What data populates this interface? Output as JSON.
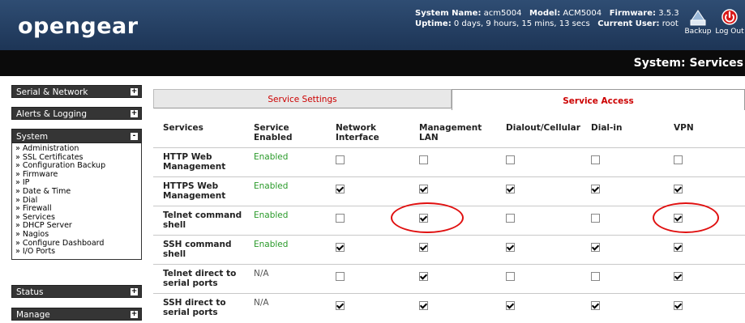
{
  "header": {
    "logo": "opengear",
    "system_name_label": "System Name:",
    "system_name": "acm5004",
    "model_label": "Model:",
    "model": "ACM5004",
    "firmware_label": "Firmware:",
    "firmware": "3.5.3",
    "uptime_label": "Uptime:",
    "uptime": "0 days, 9 hours, 15 mins, 13 secs",
    "user_label": "Current User:",
    "user": "root",
    "backup_label": "Backup",
    "logout_label": "Log Out"
  },
  "page_title": "System: Services",
  "sidebar": {
    "sections": [
      {
        "label": "Serial & Network",
        "toggle": "+"
      },
      {
        "label": "Alerts & Logging",
        "toggle": "+"
      },
      {
        "label": "System",
        "toggle": "-"
      },
      {
        "label": "Status",
        "toggle": "+"
      },
      {
        "label": "Manage",
        "toggle": "+"
      }
    ],
    "system_items": [
      "» Administration",
      "» SSL Certificates",
      "» Configuration Backup",
      "» Firmware",
      "» IP",
      "» Date & Time",
      "» Dial",
      "» Firewall",
      "» Services",
      "» DHCP Server",
      "» Nagios",
      "» Configure Dashboard",
      "» I/O Ports"
    ]
  },
  "tabs": {
    "service_settings": "Service Settings",
    "service_access": "Service Access"
  },
  "table": {
    "columns": [
      "Services",
      "Service Enabled",
      "Network Interface",
      "Management LAN",
      "Dialout/Cellular",
      "Dial-in",
      "VPN"
    ],
    "rows": [
      {
        "name": "HTTP Web Management",
        "status": "Enabled",
        "access": [
          false,
          false,
          false,
          false,
          false
        ]
      },
      {
        "name": "HTTPS Web Management",
        "status": "Enabled",
        "access": [
          true,
          true,
          true,
          true,
          true
        ]
      },
      {
        "name": "Telnet command shell",
        "status": "Enabled",
        "access": [
          false,
          true,
          false,
          false,
          true
        ]
      },
      {
        "name": "SSH command shell",
        "status": "Enabled",
        "access": [
          true,
          true,
          true,
          true,
          true
        ]
      },
      {
        "name": "Telnet direct to serial ports",
        "status": "N/A",
        "access": [
          false,
          true,
          false,
          false,
          true
        ]
      },
      {
        "name": "SSH direct to serial ports",
        "status": "N/A",
        "access": [
          true,
          true,
          true,
          true,
          true
        ]
      }
    ]
  },
  "colors": {
    "header_bg": "#243f63",
    "tab_text": "#cc0000",
    "enabled_text": "#2a9a2a",
    "annotation_ring": "#e01010"
  }
}
